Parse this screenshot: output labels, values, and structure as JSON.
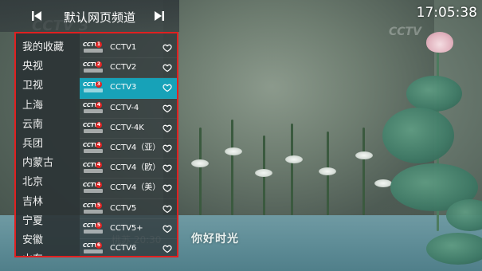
{
  "header": {
    "source_title": "默认网页频道",
    "prev_icon": "skip-previous-icon",
    "next_icon": "skip-next-icon"
  },
  "clock": "17:05:38",
  "video": {
    "subtitle": "你好时光"
  },
  "categories": [
    {
      "label": "我的收藏"
    },
    {
      "label": "央视"
    },
    {
      "label": "卫视"
    },
    {
      "label": "上海"
    },
    {
      "label": "云南"
    },
    {
      "label": "兵团"
    },
    {
      "label": "内蒙古"
    },
    {
      "label": "北京"
    },
    {
      "label": "吉林"
    },
    {
      "label": "宁夏"
    },
    {
      "label": "安徽"
    },
    {
      "label": "山东"
    }
  ],
  "channels": [
    {
      "name": "CCTV1",
      "num": "1",
      "selected": false
    },
    {
      "name": "CCTV2",
      "num": "2",
      "selected": false
    },
    {
      "name": "CCTV3",
      "num": "3",
      "selected": true
    },
    {
      "name": "CCTV-4",
      "num": "4",
      "selected": false
    },
    {
      "name": "CCTV-4K",
      "num": "4",
      "selected": false
    },
    {
      "name": "CCTV4（亚）",
      "num": "4",
      "selected": false
    },
    {
      "name": "CCTV4（欧）",
      "num": "4",
      "selected": false
    },
    {
      "name": "CCTV4（美）",
      "num": "4",
      "selected": false
    },
    {
      "name": "CCTV5",
      "num": "5",
      "selected": false
    },
    {
      "name": "CCTV5+",
      "num": "5",
      "selected": false
    },
    {
      "name": "CCTV6",
      "num": "6",
      "selected": false
    }
  ],
  "colors": {
    "selected_bg": "#17a2b8",
    "panel_border": "#e02020"
  }
}
